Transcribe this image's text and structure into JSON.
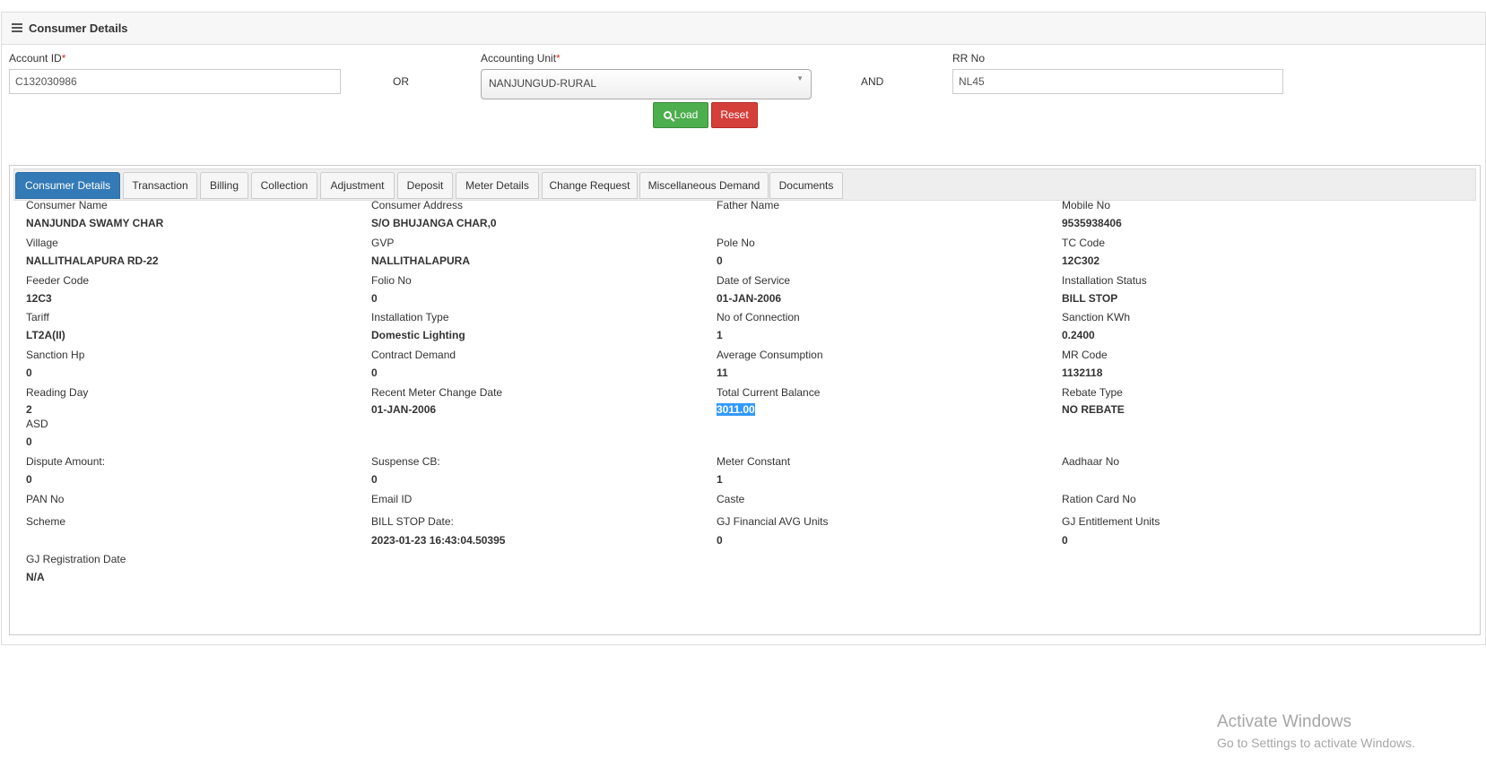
{
  "header": {
    "title": "Consumer Details"
  },
  "form": {
    "account_id_label": "Account ID",
    "required_mark": "*",
    "account_id_value": "C132030986",
    "or_text": "OR",
    "accounting_unit_label": "Accounting Unit",
    "accounting_unit_value": "NANJUNGUD-RURAL",
    "and_text": "AND",
    "rr_no_label": "RR No",
    "rr_no_value": "NL45",
    "load_label": "Load",
    "reset_label": "Reset"
  },
  "tabs": [
    "Consumer Details",
    "Transaction",
    "Billing",
    "Collection",
    "Adjustment",
    "Deposit",
    "Meter Details",
    "Change Request",
    "Miscellaneous Demand",
    "Documents"
  ],
  "active_tab": "Consumer Details",
  "fields": [
    {
      "label": "Consumer Name",
      "value": "NANJUNDA SWAMY CHAR"
    },
    {
      "label": "Consumer Address",
      "value": "S/O BHUJANGA CHAR,0"
    },
    {
      "label": "Father Name",
      "value": ""
    },
    {
      "label": "Mobile No",
      "value": "9535938406"
    },
    {
      "label": "Village",
      "value": "NALLITHALAPURA RD-22"
    },
    {
      "label": "GVP",
      "value": "NALLITHALAPURA"
    },
    {
      "label": "Pole No",
      "value": "0"
    },
    {
      "label": "TC Code",
      "value": "12C302"
    },
    {
      "label": "Feeder Code",
      "value": "12C3"
    },
    {
      "label": "Folio No",
      "value": "0"
    },
    {
      "label": "Date of Service",
      "value": "01-JAN-2006"
    },
    {
      "label": "Installation Status",
      "value": "BILL STOP"
    },
    {
      "label": "Tariff",
      "value": "LT2A(II)"
    },
    {
      "label": "Installation Type",
      "value": "Domestic Lighting"
    },
    {
      "label": "No of Connection",
      "value": "1"
    },
    {
      "label": "Sanction KWh",
      "value": "0.2400"
    },
    {
      "label": "Sanction Hp",
      "value": "0"
    },
    {
      "label": "Contract Demand",
      "value": "0"
    },
    {
      "label": "Average Consumption",
      "value": "11"
    },
    {
      "label": "MR Code",
      "value": "1132118"
    },
    {
      "label": "Reading Day",
      "value": "2"
    },
    {
      "label": "Recent Meter Change Date",
      "value": "01-JAN-2006"
    },
    {
      "label": "Total Current Balance",
      "value": "3011.00",
      "selected": true
    },
    {
      "label": "Rebate Type",
      "value": "NO REBATE"
    },
    {
      "label": "ASD",
      "value": "0"
    },
    {
      "label": "Dispute Amount:",
      "value": "0"
    },
    {
      "label": "Suspense CB:",
      "value": "0"
    },
    {
      "label": "Meter Constant",
      "value": "1"
    },
    {
      "label": "Aadhaar No",
      "value": ""
    },
    {
      "label": "PAN No",
      "value": ""
    },
    {
      "label": "Email ID",
      "value": ""
    },
    {
      "label": "Caste",
      "value": ""
    },
    {
      "label": "Ration Card No",
      "value": ""
    },
    {
      "label": "Scheme",
      "value": ""
    },
    {
      "label": "BILL STOP Date:",
      "value": "2023-01-23 16:43:04.50395"
    },
    {
      "label": "GJ Financial AVG Units",
      "value": "0"
    },
    {
      "label": "GJ Entitlement Units",
      "value": "0"
    },
    {
      "label": "GJ Registration Date",
      "value": "N/A"
    }
  ],
  "watermark": {
    "title": "Activate Windows",
    "subtitle": "Go to Settings to activate Windows."
  },
  "colors": {
    "active_tab": "#337ab7",
    "load_button": "#4cae4c",
    "reset_button": "#d43f3a",
    "required": "#d9302c",
    "selection": "#3399ff"
  },
  "icons": {
    "menu": "menu-icon",
    "search": "search-icon",
    "select_arrow": "chevron-down-icon"
  }
}
